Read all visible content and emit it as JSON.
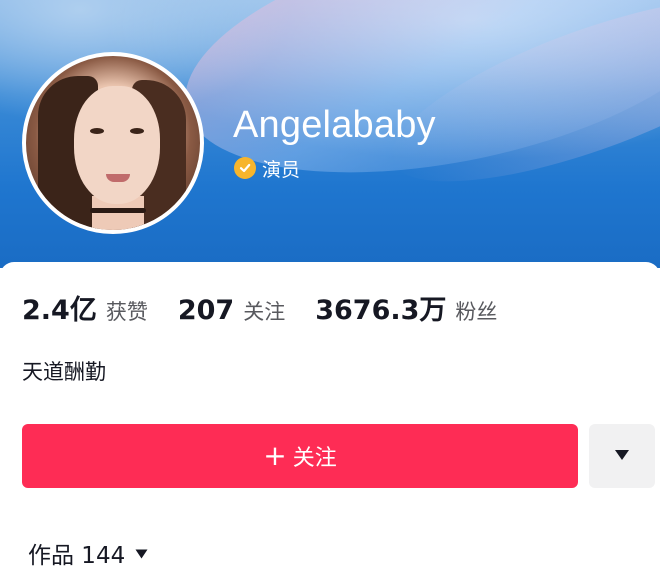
{
  "profile": {
    "name": "Angelababy",
    "verify_label": "演员",
    "bio": "天道酬勤"
  },
  "stats": [
    {
      "value": "2.4亿",
      "label": "获赞"
    },
    {
      "value": "207",
      "label": "关注"
    },
    {
      "value": "3676.3万",
      "label": "粉丝"
    }
  ],
  "actions": {
    "follow_plus": "+",
    "follow_label": "关注",
    "more_icon": "triangle-down-icon"
  },
  "tabs": {
    "works_label": "作品 144"
  },
  "colors": {
    "follow_button": "#fe2c55",
    "verify_badge": "#f7b52c",
    "banner": "#1f76cf"
  }
}
